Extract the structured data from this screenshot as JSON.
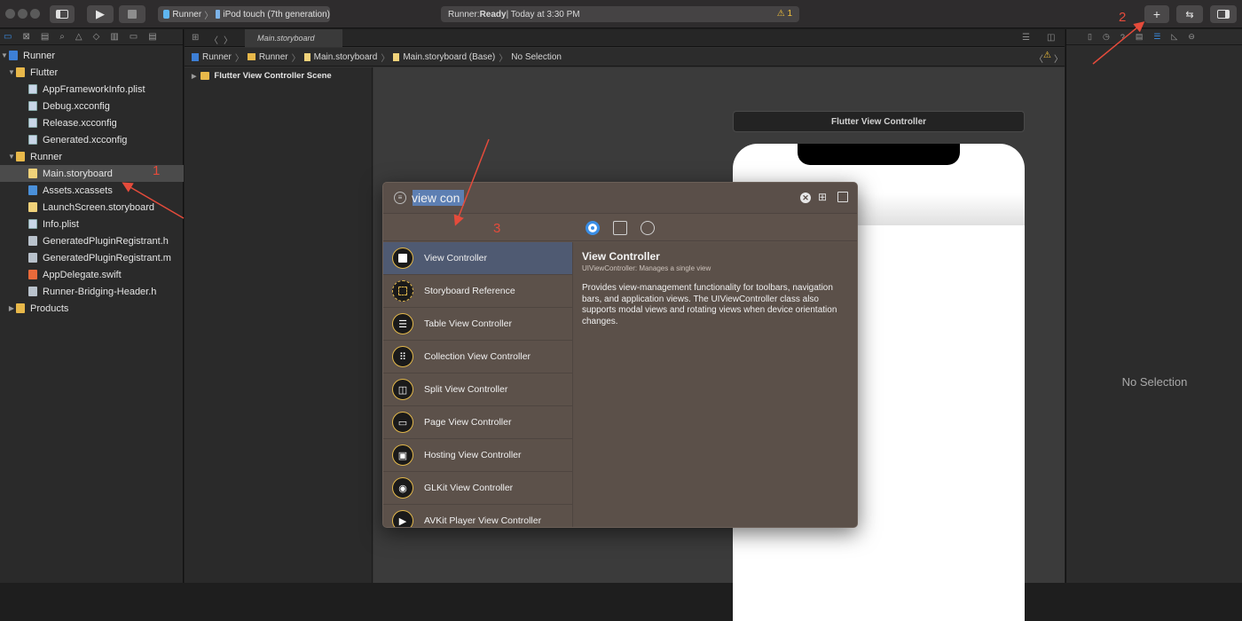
{
  "toolbar": {
    "scheme_target": "Runner",
    "scheme_device": "iPod touch (7th generation)",
    "status_label": "Runner: ",
    "status_state": "Ready",
    "status_time": " | Today at 3:30 PM",
    "warning_count": "1",
    "add_label": "+"
  },
  "editor": {
    "tab_label": "Main.storyboard",
    "jump_bar": [
      "Runner",
      "Runner",
      "Main.storyboard",
      "Main.storyboard (Base)",
      "No Selection"
    ],
    "outline_scene": "Flutter View Controller Scene",
    "scene_title": "Flutter View Controller"
  },
  "navigator": {
    "items": [
      {
        "label": "Runner"
      },
      {
        "label": "Flutter"
      },
      {
        "label": "AppFrameworkInfo.plist"
      },
      {
        "label": "Debug.xcconfig"
      },
      {
        "label": "Release.xcconfig"
      },
      {
        "label": "Generated.xcconfig"
      },
      {
        "label": "Runner"
      },
      {
        "label": "Main.storyboard"
      },
      {
        "label": "Assets.xcassets"
      },
      {
        "label": "LaunchScreen.storyboard"
      },
      {
        "label": "Info.plist"
      },
      {
        "label": "GeneratedPluginRegistrant.h"
      },
      {
        "label": "GeneratedPluginRegistrant.m"
      },
      {
        "label": "AppDelegate.swift"
      },
      {
        "label": "Runner-Bridging-Header.h"
      },
      {
        "label": "Products"
      }
    ]
  },
  "library": {
    "search_value": "view con",
    "items": [
      {
        "label": "View Controller"
      },
      {
        "label": "Storyboard Reference"
      },
      {
        "label": "Table View Controller"
      },
      {
        "label": "Collection View Controller"
      },
      {
        "label": "Split View Controller"
      },
      {
        "label": "Page View Controller"
      },
      {
        "label": "Hosting View Controller"
      },
      {
        "label": "GLKit View Controller"
      },
      {
        "label": "AVKit Player View Controller"
      }
    ],
    "detail": {
      "title": "View Controller",
      "subtitle": "UIViewController: Manages a single view",
      "body": "Provides view-management functionality for toolbars, navigation bars, and application views. The UIViewController class also supports modal views and rotating views when device orientation changes."
    }
  },
  "inspector": {
    "no_selection": "No Selection"
  },
  "annotations": {
    "one": "1",
    "two": "2",
    "three": "3"
  },
  "colors": {
    "annotation_red": "#e54b3b",
    "selection_blue": "#4f5a72",
    "accent_blue": "#3a8ee6",
    "library_bg": "#5e524b"
  }
}
